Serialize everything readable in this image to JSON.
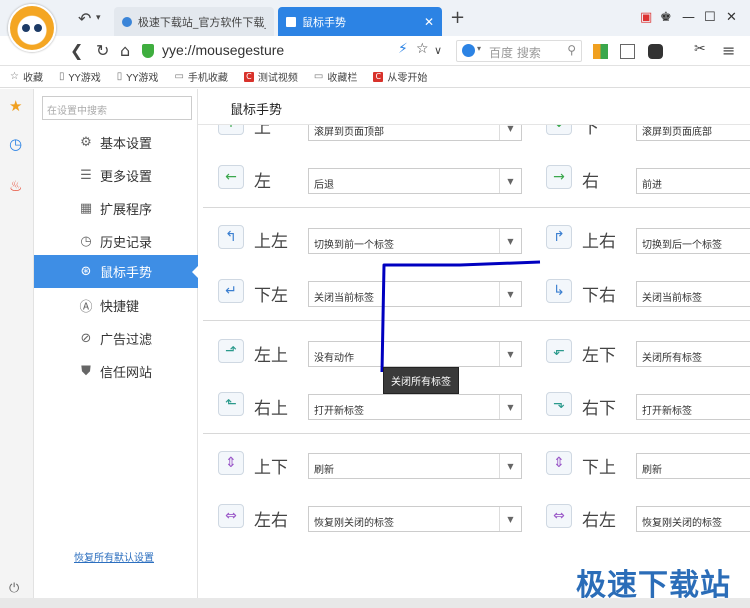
{
  "browser": {
    "tabs": [
      {
        "title": "极速下载站_官方软件下载_"
      },
      {
        "title": "鼠标手势"
      }
    ],
    "url": "yye://mousegesture",
    "search_placeholder": "百度 搜索"
  },
  "bookmarks": [
    {
      "label": "收藏",
      "icon": "star-icon"
    },
    {
      "label": "YY游戏",
      "icon": "page-icon"
    },
    {
      "label": "YY游戏",
      "icon": "page-icon"
    },
    {
      "label": "手机收藏",
      "icon": "folder-icon"
    },
    {
      "label": "测试视频",
      "icon": "c-red-icon"
    },
    {
      "label": "收藏栏",
      "icon": "folder-icon"
    },
    {
      "label": "从零开始",
      "icon": "c-red-icon"
    }
  ],
  "settings": {
    "search_placeholder": "在设置中搜索",
    "menu": [
      {
        "label": "基本设置",
        "icon": "gear-icon"
      },
      {
        "label": "更多设置",
        "icon": "list-icon"
      },
      {
        "label": "扩展程序",
        "icon": "grid-icon"
      },
      {
        "label": "历史记录",
        "icon": "clock-icon"
      },
      {
        "label": "鼠标手势",
        "icon": "gesture-icon",
        "active": true
      },
      {
        "label": "快捷键",
        "icon": "a-key-icon"
      },
      {
        "label": "广告过滤",
        "icon": "block-icon"
      },
      {
        "label": "信任网站",
        "icon": "shield-icon"
      }
    ],
    "restore_label": "恢复所有默认设置"
  },
  "page": {
    "title": "鼠标手势",
    "gestures": [
      {
        "label": "上",
        "action": "滚屏到页面顶部"
      },
      {
        "label": "下",
        "action": "滚屏到页面底部"
      },
      {
        "label": "左",
        "action": "后退"
      },
      {
        "label": "右",
        "action": "前进"
      },
      {
        "label": "上左",
        "action": "切换到前一个标签"
      },
      {
        "label": "上右",
        "action": "切换到后一个标签"
      },
      {
        "label": "下左",
        "action": "关闭当前标签"
      },
      {
        "label": "下右",
        "action": "关闭当前标签"
      },
      {
        "label": "左上",
        "action": "没有动作"
      },
      {
        "label": "左下",
        "action": "关闭所有标签"
      },
      {
        "label": "右上",
        "action": "打开新标签"
      },
      {
        "label": "右下",
        "action": "打开新标签"
      },
      {
        "label": "上下",
        "action": "刷新"
      },
      {
        "label": "下上",
        "action": "刷新"
      },
      {
        "label": "左右",
        "action": "恢复刚关闭的标签"
      },
      {
        "label": "右左",
        "action": "恢复刚关闭的标签"
      }
    ],
    "tooltip": "关闭所有标签"
  },
  "watermark": "极速下载站",
  "colors": {
    "accent": "#2c83e4",
    "active_menu": "#3e8ee5",
    "gesture_line": "#0000c0"
  }
}
